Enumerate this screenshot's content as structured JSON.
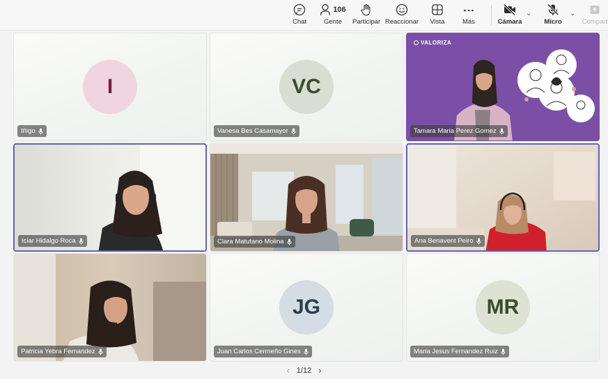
{
  "toolbar": {
    "chat": "Chat",
    "people": "Gente",
    "people_count": "106",
    "raise": "Participar",
    "react": "Reaccionar",
    "view": "Vista",
    "more": "Más",
    "camera": "Cámara",
    "mic": "Micro",
    "share": "Compart"
  },
  "tiles": [
    {
      "name": "Iñigo",
      "initials": "I",
      "color": "#f0d5e0",
      "text_color": "#7a1f3d"
    },
    {
      "name": "Vanesa Bes Casamayor",
      "initials": "VC",
      "color": "#d9ded3",
      "text_color": "#3a4a2e"
    },
    {
      "name": "Tamara Maria Perez Gomez",
      "logo": "VALORIZA"
    },
    {
      "name": "Iciar Hidalgo Roca"
    },
    {
      "name": "Clara Matutano Molina"
    },
    {
      "name": "Ana Benavent Peiro"
    },
    {
      "name": "Patricia Yebra Fernandez"
    },
    {
      "name": "Juan Carlos Cermeño Gines",
      "initials": "JG",
      "color": "#d4dde3",
      "text_color": "#2c3e4e"
    },
    {
      "name": "Maria Jesus Fernandez Ruiz",
      "initials": "MR",
      "color": "#dde3d3",
      "text_color": "#3a4a2e"
    }
  ],
  "pager": {
    "label": "1/12"
  },
  "colors": {
    "accent": "#6264a7",
    "brand_purple": "#7b4fa6"
  }
}
